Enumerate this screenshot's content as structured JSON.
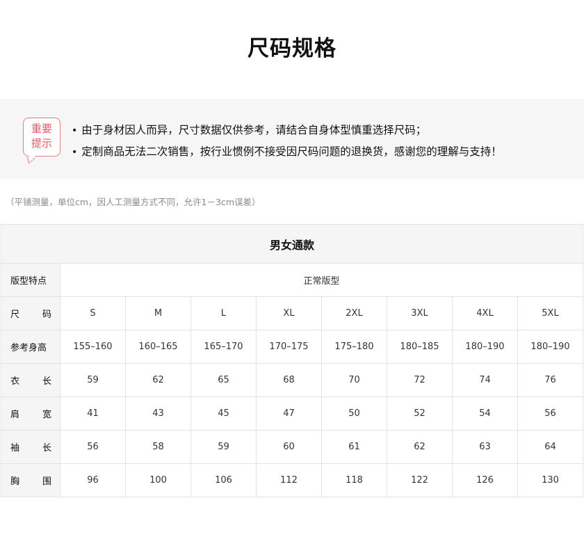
{
  "page": {
    "title": "尺码规格"
  },
  "notice": {
    "badge_line1": "重要",
    "badge_line2": "提示",
    "tips": [
      "由于身材因人而异，尺寸数据仅供参考，请结合自身体型慎重选择尺码；",
      "定制商品无法二次销售，按行业惯例不接受因尺码问题的退换货，感谢您的理解与支持！"
    ]
  },
  "measure_note": "（平铺测量，单位cm，因人工测量方式不同，允许1－3cm误差）",
  "table": {
    "title": "男女通款",
    "fit_label": "版型特点",
    "fit_value": "正常版型",
    "size_label": "尺        码",
    "sizes": [
      "S",
      "M",
      "L",
      "XL",
      "2XL",
      "3XL",
      "4XL",
      "5XL"
    ],
    "rows": [
      {
        "label": "参考身高",
        "values": [
          "155–160",
          "160–165",
          "165–170",
          "170–175",
          "175–180",
          "180–185",
          "180–190",
          "180–190"
        ]
      },
      {
        "label": "衣        长",
        "values": [
          "59",
          "62",
          "65",
          "68",
          "70",
          "72",
          "74",
          "76"
        ]
      },
      {
        "label": "肩        宽",
        "values": [
          "41",
          "43",
          "45",
          "47",
          "50",
          "52",
          "54",
          "56"
        ]
      },
      {
        "label": "袖        长",
        "values": [
          "56",
          "58",
          "59",
          "60",
          "61",
          "62",
          "63",
          "64"
        ]
      },
      {
        "label": "胸        围",
        "values": [
          "96",
          "100",
          "106",
          "112",
          "118",
          "122",
          "126",
          "130"
        ]
      }
    ]
  },
  "colors": {
    "accent": "#e05a64",
    "panel_bg": "#f6f6f6",
    "border": "#e2e2e2"
  }
}
